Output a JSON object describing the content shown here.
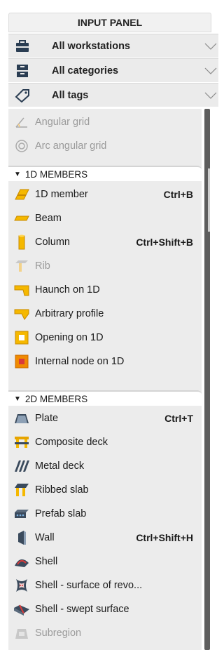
{
  "panel": {
    "title": "INPUT PANEL"
  },
  "filters": [
    {
      "label": "All workstations",
      "icon": "briefcase-icon"
    },
    {
      "label": "All categories",
      "icon": "categories-icon"
    },
    {
      "label": "All tags",
      "icon": "tag-icon"
    }
  ],
  "top_items": [
    {
      "label": "Angular grid",
      "icon": "angular-grid-icon",
      "disabled": true
    },
    {
      "label": "Arc angular grid",
      "icon": "arc-angular-grid-icon",
      "disabled": true
    }
  ],
  "groups": {
    "members_1d": {
      "title": "1D MEMBERS",
      "items": [
        {
          "label": "1D member",
          "shortcut": "Ctrl+B",
          "icon": "1d-member-icon"
        },
        {
          "label": "Beam",
          "shortcut": "",
          "icon": "beam-icon"
        },
        {
          "label": "Column",
          "shortcut": "Ctrl+Shift+B",
          "icon": "column-icon"
        },
        {
          "label": "Rib",
          "shortcut": "",
          "icon": "rib-icon",
          "disabled": true
        },
        {
          "label": "Haunch on 1D",
          "shortcut": "",
          "icon": "haunch-icon"
        },
        {
          "label": "Arbitrary profile",
          "shortcut": "",
          "icon": "arbitrary-profile-icon"
        },
        {
          "label": "Opening on 1D",
          "shortcut": "",
          "icon": "opening-1d-icon"
        },
        {
          "label": "Internal node on 1D",
          "shortcut": "",
          "icon": "internal-node-icon"
        }
      ]
    },
    "members_2d": {
      "title": "2D MEMBERS",
      "items": [
        {
          "label": "Plate",
          "shortcut": "Ctrl+T",
          "icon": "plate-icon"
        },
        {
          "label": "Composite deck",
          "shortcut": "",
          "icon": "composite-deck-icon"
        },
        {
          "label": "Metal deck",
          "shortcut": "",
          "icon": "metal-deck-icon"
        },
        {
          "label": "Ribbed slab",
          "shortcut": "",
          "icon": "ribbed-slab-icon"
        },
        {
          "label": "Prefab slab",
          "shortcut": "",
          "icon": "prefab-slab-icon"
        },
        {
          "label": "Wall",
          "shortcut": "Ctrl+Shift+H",
          "icon": "wall-icon"
        },
        {
          "label": "Shell",
          "shortcut": "",
          "icon": "shell-icon"
        },
        {
          "label": "Shell - surface of revo...",
          "shortcut": "",
          "icon": "shell-revolution-icon"
        },
        {
          "label": "Shell - swept surface",
          "shortcut": "",
          "icon": "shell-swept-icon"
        },
        {
          "label": "Subregion",
          "shortcut": "",
          "icon": "subregion-icon",
          "disabled": true
        }
      ]
    }
  },
  "colors": {
    "accent_yellow": "#f5b800",
    "accent_orange": "#f08a00",
    "dark_icon": "#3a4a5c",
    "disabled": "#9a9a9a"
  }
}
